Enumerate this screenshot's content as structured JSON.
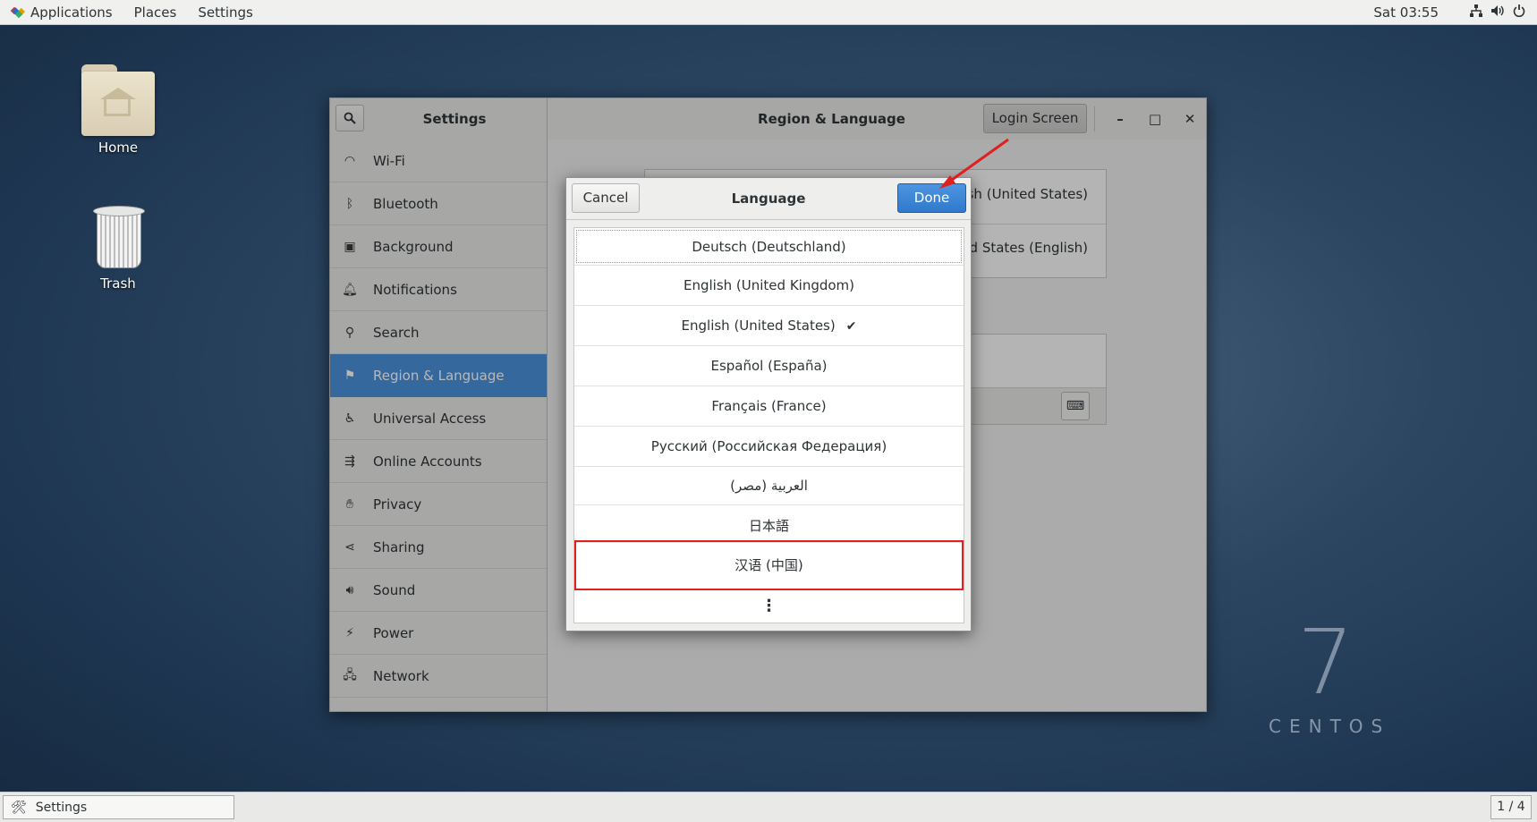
{
  "topbar": {
    "menus": [
      "Applications",
      "Places",
      "Settings"
    ],
    "clock": "Sat 03:55",
    "tray_icons": [
      "network-icon",
      "volume-icon",
      "power-icon"
    ]
  },
  "desktop": {
    "icons": [
      {
        "label": "Home",
        "icon": "home-folder-icon"
      },
      {
        "label": "Trash",
        "icon": "trash-icon"
      }
    ],
    "watermark_number": "7",
    "watermark_text": "CENTOS"
  },
  "window": {
    "sidebar_title": "Settings",
    "panel_title": "Region & Language",
    "login_screen_button": "Login Screen",
    "controls": {
      "minimize": "–",
      "maximize": "□",
      "close": "✕"
    },
    "sidebar": [
      {
        "label": "Wi-Fi",
        "icon": "wifi-icon",
        "glyph": "◠"
      },
      {
        "label": "Bluetooth",
        "icon": "bluetooth-icon",
        "glyph": "ᛒ"
      },
      {
        "label": "Background",
        "icon": "background-icon",
        "glyph": "▣"
      },
      {
        "label": "Notifications",
        "icon": "bell-icon",
        "glyph": "🔔︎"
      },
      {
        "label": "Search",
        "icon": "search-icon",
        "glyph": "⚲"
      },
      {
        "label": "Region & Language",
        "icon": "flag-icon",
        "glyph": "⚑",
        "active": true
      },
      {
        "label": "Universal Access",
        "icon": "accessibility-icon",
        "glyph": "♿︎"
      },
      {
        "label": "Online Accounts",
        "icon": "online-accounts-icon",
        "glyph": "⇶"
      },
      {
        "label": "Privacy",
        "icon": "hand-icon",
        "glyph": "✋︎"
      },
      {
        "label": "Sharing",
        "icon": "share-icon",
        "glyph": "⋖"
      },
      {
        "label": "Sound",
        "icon": "speaker-icon",
        "glyph": "🔊︎"
      },
      {
        "label": "Power",
        "icon": "power-icon",
        "glyph": "⚡︎"
      },
      {
        "label": "Network",
        "icon": "network-icon",
        "glyph": "🖧︎"
      }
    ],
    "content": {
      "language_value_partial": "glish (United States)",
      "formats_value_partial": "ited States (English)"
    }
  },
  "dialog": {
    "title": "Language",
    "cancel_label": "Cancel",
    "done_label": "Done",
    "languages": [
      {
        "label": "Deutsch (Deutschland)",
        "selected": false
      },
      {
        "label": "English (United Kingdom)",
        "selected": false
      },
      {
        "label": "English (United States)",
        "selected": true
      },
      {
        "label": "Español (España)",
        "selected": false
      },
      {
        "label": "Français (France)",
        "selected": false
      },
      {
        "label": "Русский (Российская Федерация)",
        "selected": false
      },
      {
        "label": "العربية (مصر)",
        "selected": false
      },
      {
        "label": "日本語",
        "selected": false
      },
      {
        "label": "汉语 (中国)",
        "selected": false,
        "highlighted": true
      }
    ],
    "check_mark": "✔",
    "more_glyph": "⋮"
  },
  "taskbar": {
    "window_label": "Settings",
    "workspace": "1 / 4"
  },
  "colors": {
    "accent": "#4a90d9",
    "done_button": "#3079cc",
    "annotation": "#e02020"
  }
}
